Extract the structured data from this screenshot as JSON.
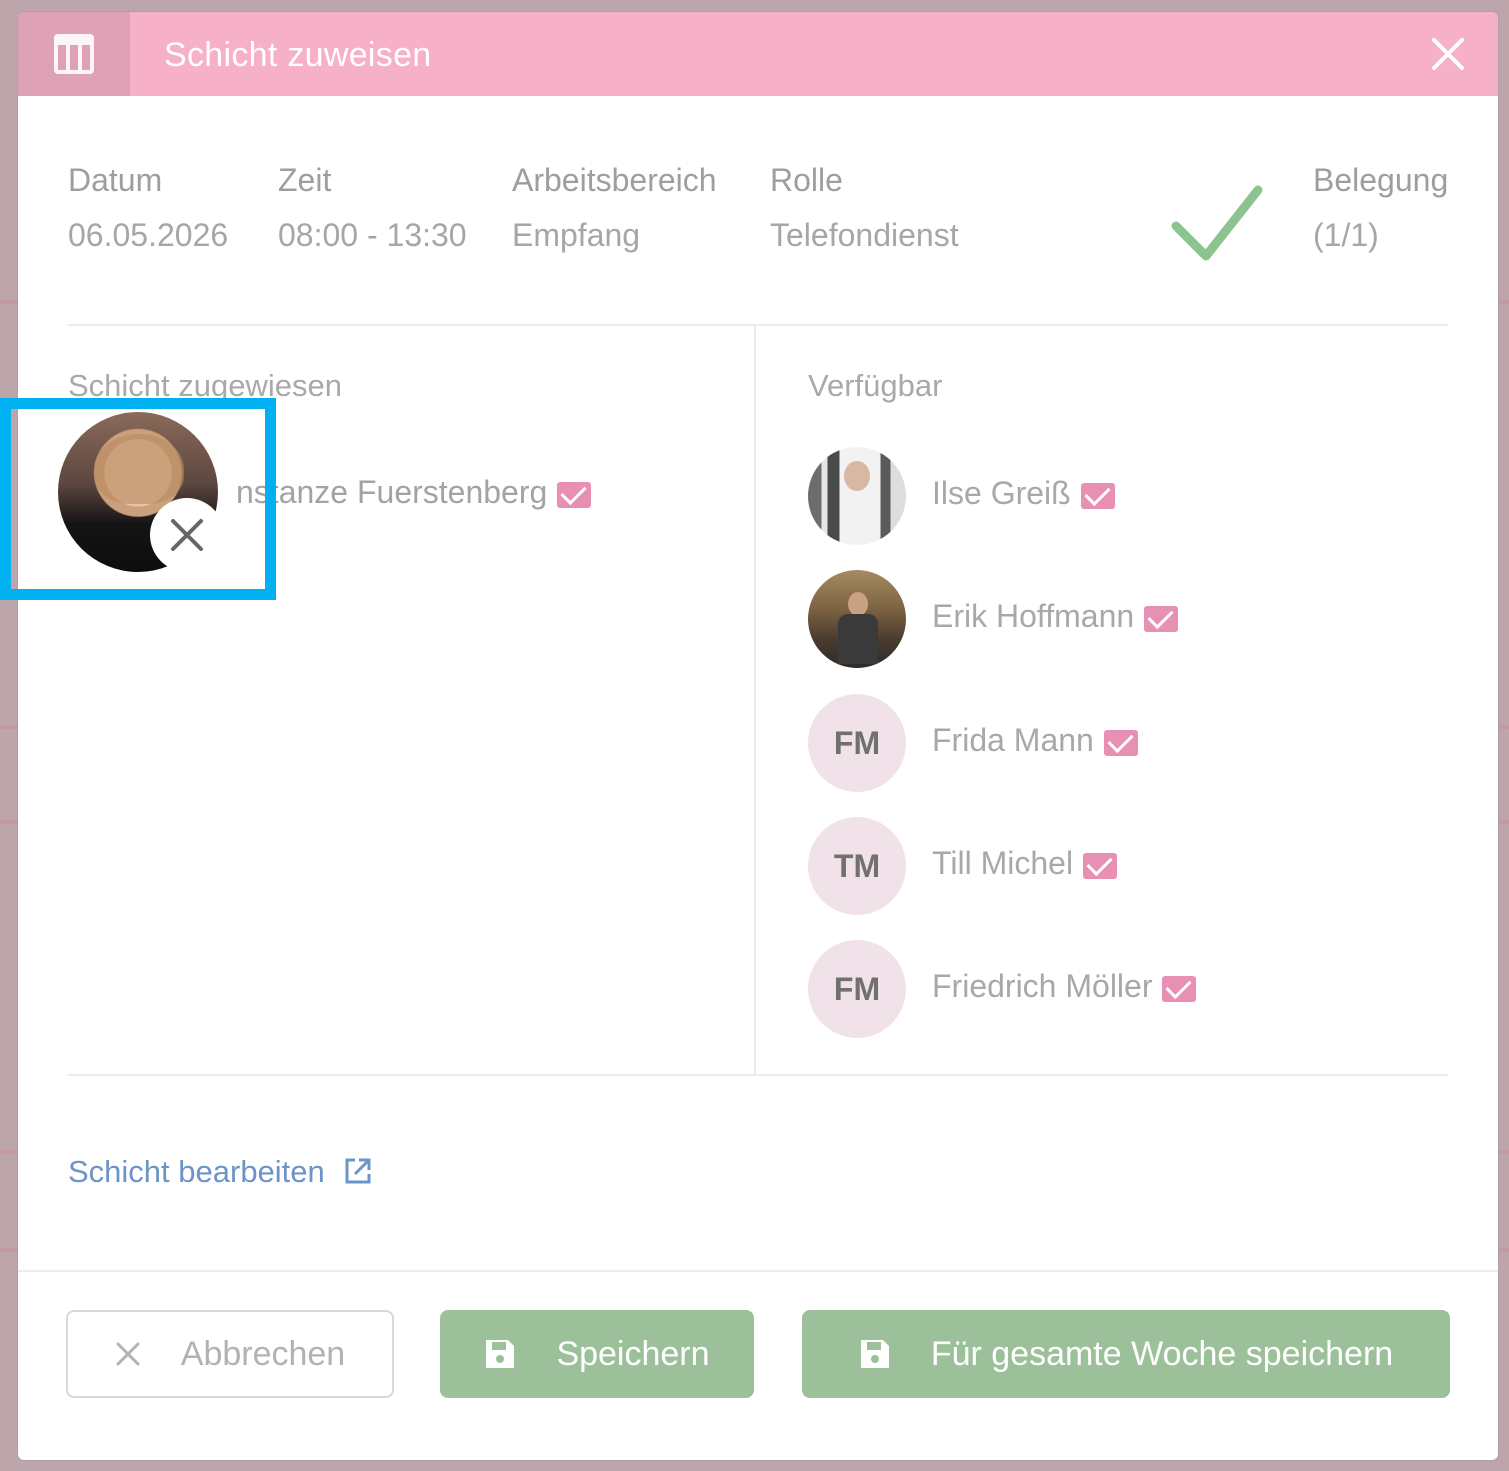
{
  "dialog": {
    "title": "Schicht zuweisen",
    "header_icon": "table-layout-icon",
    "close_icon": "close-icon"
  },
  "shift": {
    "date_label": "Datum",
    "date": "06.05.2026",
    "time_label": "Zeit",
    "time": "08:00 - 13:30",
    "area_label": "Arbeitsbereich",
    "area": "Empfang",
    "role_label": "Rolle",
    "role": "Telefondienst",
    "status_icon": "checkmark-icon",
    "occupancy_label": "Belegung",
    "occupancy": "(1/1)"
  },
  "assigned": {
    "title": "Schicht zugewiesen",
    "people": [
      {
        "name": "nstanze Fuerstenberg",
        "avatar": "photo",
        "icon": "mail-icon",
        "remove_icon": "close-icon"
      }
    ]
  },
  "available": {
    "title": "Verfügbar",
    "people": [
      {
        "name": "Ilse Greiß",
        "initials": "",
        "avatar": "photo"
      },
      {
        "name": "Erik Hoffmann",
        "initials": "",
        "avatar": "photo"
      },
      {
        "name": "Frida Mann",
        "initials": "FM",
        "avatar": "initials"
      },
      {
        "name": "Till Michel",
        "initials": "TM",
        "avatar": "initials"
      },
      {
        "name": "Friedrich Möller",
        "initials": "FM",
        "avatar": "initials"
      }
    ]
  },
  "footer": {
    "edit_link": "Schicht bearbeiten",
    "edit_icon": "external-link-icon",
    "cancel": "Abbrechen",
    "save": "Speichern",
    "save_week": "Für gesamte Woche speichern"
  },
  "colors": {
    "header": "#f6b0c8",
    "accent_green": "#9cc19a",
    "mail_pink": "#e790b3",
    "link_blue": "#6d94c7",
    "focus_blue": "#00b0f0"
  }
}
